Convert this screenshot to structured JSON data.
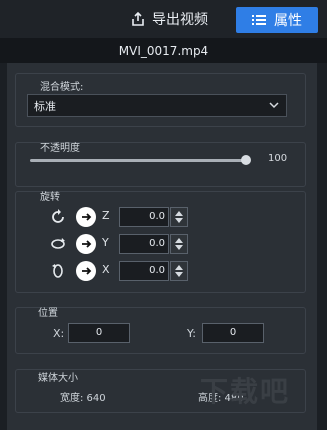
{
  "header": {
    "export_label": "导出视频",
    "properties_label": "属性"
  },
  "file": {
    "name": "MVI_0017.mp4"
  },
  "blend": {
    "label": "混合模式:",
    "selected": "标准"
  },
  "opacity": {
    "label": "不透明度",
    "value": "100"
  },
  "rotation": {
    "label": "旋转",
    "rows": [
      {
        "axis": "Z",
        "value": "0.0"
      },
      {
        "axis": "Y",
        "value": "0.0"
      },
      {
        "axis": "X",
        "value": "0.0"
      }
    ]
  },
  "position": {
    "label": "位置",
    "x_label": "X:",
    "x_value": "0",
    "y_label": "Y:",
    "y_value": "0"
  },
  "media": {
    "label": "媒体大小",
    "width_label": "宽度: 640",
    "height_label": "高度: 480"
  },
  "watermark": "下载吧",
  "colors": {
    "accent": "#2f7ee6",
    "background": "#1b1f24",
    "panel": "#2b3036"
  }
}
